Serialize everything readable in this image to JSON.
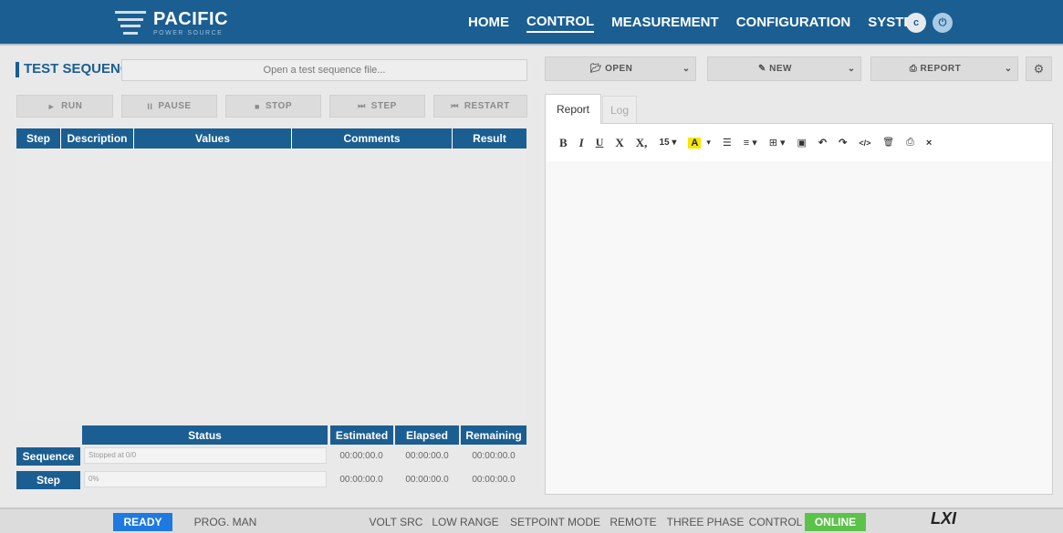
{
  "header": {
    "brand": "PACIFIC",
    "brand_sub": "POWER SOURCE",
    "nav": [
      "HOME",
      "CONTROL",
      "MEASUREMENT",
      "CONFIGURATION",
      "SYSTEM"
    ],
    "active_nav": "CONTROL",
    "icon_c": "c",
    "icon_power": "⏻",
    "colors": {
      "header_bg": "#1b5e92",
      "ready": "#1e7ae0",
      "online": "#5cc24a",
      "highlight": "#f7e600"
    }
  },
  "test_sequence": {
    "title": "TEST SEQUENCE",
    "file_placeholder": "Open a test sequence file...",
    "controls": [
      {
        "icon": "►",
        "label": "RUN"
      },
      {
        "icon": "II",
        "label": "PAUSE"
      },
      {
        "icon": "■",
        "label": "STOP"
      },
      {
        "icon": "⏭",
        "label": "STEP"
      },
      {
        "icon": "⏮",
        "label": "RESTART"
      }
    ],
    "columns": [
      "Step",
      "Description",
      "Values",
      "Comments",
      "Result"
    ],
    "rows": []
  },
  "status": {
    "columns": [
      "Status",
      "Estimated",
      "Elapsed",
      "Remaining"
    ],
    "rows": [
      {
        "label": "Sequence",
        "status": "Stopped at 0/0",
        "estimated": "00:00:00.0",
        "elapsed": "00:00:00.0",
        "remaining": "00:00:00.0"
      },
      {
        "label": "Step",
        "status": "0%",
        "estimated": "00:00:00.0",
        "elapsed": "00:00:00.0",
        "remaining": "00:00:00.0"
      }
    ]
  },
  "right_toolbar": {
    "open_label": "OPEN",
    "new_label": "NEW",
    "report_label": "REPORT",
    "open_icon": "folder-icon",
    "new_icon": "new-file-icon",
    "report_icon": "print-icon",
    "chevron": "⌄",
    "gear": "⚙"
  },
  "editor": {
    "tabs": [
      "Report",
      "Log"
    ],
    "active_tab": "Report",
    "toolbar": {
      "bold": "B",
      "italic": "I",
      "underline": "U",
      "superscript": "X",
      "subscript": "X,",
      "font_size": "15 ▾",
      "highlight": "A",
      "highlight_caret": "▾",
      "list": "☰",
      "align": "≡ ▾",
      "table": "⊞ ▾",
      "image": "▣",
      "undo": "↶",
      "redo": "↷",
      "code": "</>",
      "delete": "🗑",
      "print": "⎙",
      "clear": "×"
    }
  },
  "statusbar": {
    "ready": "READY",
    "prog": "PROG. MAN",
    "volt_src": "VOLT SRC",
    "low_range": "LOW RANGE",
    "setpoint_mode": "SETPOINT MODE",
    "remote": "REMOTE",
    "three_phase": "THREE PHASE",
    "control": "CONTROL",
    "online": "ONLINE",
    "logo": "LXI"
  }
}
